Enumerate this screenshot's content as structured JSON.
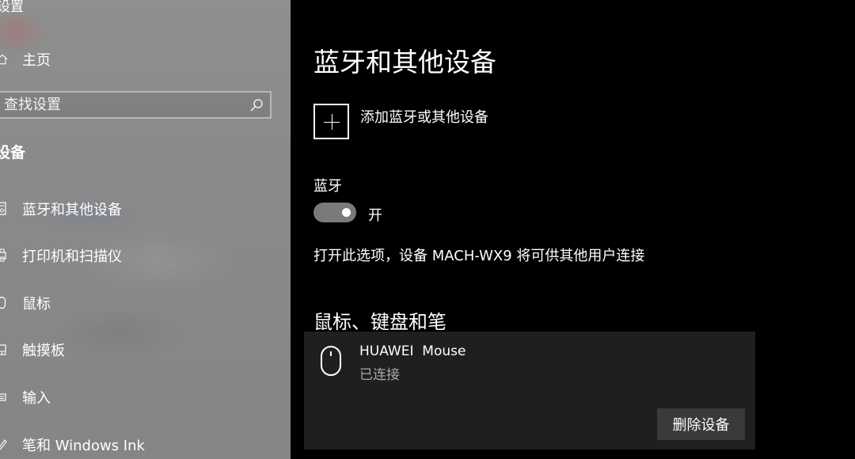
{
  "nav": {
    "window_title": "设置",
    "home_label": "主页",
    "search": {
      "placeholder": "查找设置"
    },
    "section_heading": "设备",
    "items": [
      {
        "label": "蓝牙和其他设备",
        "icon": "bluetooth-devices-icon"
      },
      {
        "label": "打印机和扫描仪",
        "icon": "printer-icon"
      },
      {
        "label": "鼠标",
        "icon": "mouse-icon"
      },
      {
        "label": "触摸板",
        "icon": "touchpad-icon"
      },
      {
        "label": "输入",
        "icon": "keyboard-icon"
      },
      {
        "label": "笔和 Windows Ink",
        "icon": "pen-icon"
      }
    ]
  },
  "main": {
    "title": "蓝牙和其他设备",
    "add_device_label": "添加蓝牙或其他设备",
    "bluetooth": {
      "label": "蓝牙",
      "state_label": "开",
      "enabled": true,
      "description": "打开此选项，设备 MACH-WX9 将可供其他用户连接"
    },
    "mouse_section": {
      "title": "鼠标、键盘和笔",
      "devices": [
        {
          "name": "HUAWEI  Mouse",
          "status": "已连接",
          "remove_label": "删除设备",
          "icon": "mouse-icon"
        }
      ]
    }
  },
  "colors": {
    "content_bg": "#000000",
    "nav_bg": "#8a8a8a",
    "card_bg": "#1f1f1f",
    "toggle_bg": "#7a7a7a",
    "button_bg": "#3a3a3a",
    "status_text": "#a8a8a8"
  }
}
